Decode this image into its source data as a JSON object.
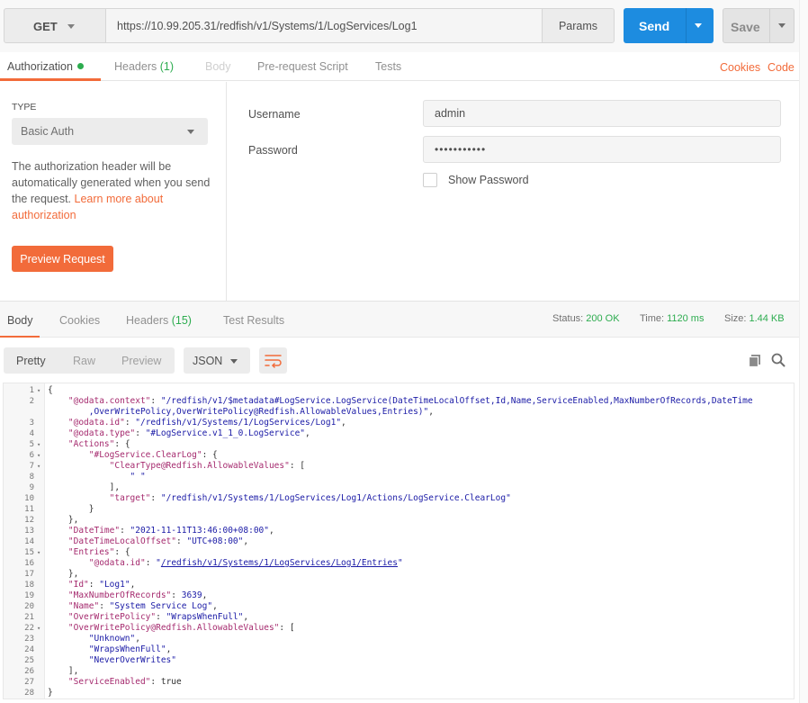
{
  "request": {
    "method": "GET",
    "url": "https://10.99.205.31/redfish/v1/Systems/1/LogServices/Log1",
    "params_label": "Params",
    "send_label": "Send",
    "save_label": "Save"
  },
  "request_tabs": {
    "authorization": "Authorization",
    "headers": "Headers",
    "headers_count": "(1)",
    "body": "Body",
    "prerequest": "Pre-request Script",
    "tests": "Tests",
    "cookies": "Cookies",
    "code": "Code"
  },
  "auth": {
    "type_label": "TYPE",
    "type_value": "Basic Auth",
    "help_text": "The authorization header will be automatically generated when you send the request. ",
    "learn_more": "Learn more about authorization",
    "preview_button": "Preview Request",
    "username_label": "Username",
    "username_value": "admin",
    "password_label": "Password",
    "password_value": "•••••••••••",
    "show_password_label": "Show Password"
  },
  "response_tabs": {
    "body": "Body",
    "cookies": "Cookies",
    "headers": "Headers",
    "headers_count": "(15)",
    "test_results": "Test Results"
  },
  "status": {
    "status_label": "Status:",
    "status_value": "200 OK",
    "time_label": "Time:",
    "time_value": "1120 ms",
    "size_label": "Size:",
    "size_value": "1.44 KB"
  },
  "view": {
    "pretty": "Pretty",
    "raw": "Raw",
    "preview": "Preview",
    "format": "JSON"
  },
  "icons": [
    "chevron-down-icon",
    "wrap-lines-icon",
    "copy-icon",
    "search-icon",
    "fold-arrow-icon"
  ],
  "colors": {
    "accent": "#f26b3a",
    "send": "#1d8ce0",
    "success": "#2dac4f"
  },
  "code_lines": [
    {
      "n": "1",
      "fold": true,
      "t": [
        [
          "p",
          "{"
        ]
      ]
    },
    {
      "n": "2",
      "fold": false,
      "t": [
        [
          "p",
          "    "
        ],
        [
          "k",
          "\"@odata.context\""
        ],
        [
          "p",
          ": "
        ],
        [
          "s",
          "\"/redfish/v1/$metadata#LogService.LogService(DateTimeLocalOffset,Id,Name,ServiceEnabled,MaxNumberOfRecords,DateTime"
        ]
      ]
    },
    {
      "n": "",
      "fold": false,
      "t": [
        [
          "s",
          "        ,OverWritePolicy,OverWritePolicy@Redfish.AllowableValues,Entries)\""
        ],
        [
          "p",
          ","
        ]
      ]
    },
    {
      "n": "3",
      "fold": false,
      "t": [
        [
          "p",
          "    "
        ],
        [
          "k",
          "\"@odata.id\""
        ],
        [
          "p",
          ": "
        ],
        [
          "s",
          "\"/redfish/v1/Systems/1/LogServices/Log1\""
        ],
        [
          "p",
          ","
        ]
      ]
    },
    {
      "n": "4",
      "fold": false,
      "t": [
        [
          "p",
          "    "
        ],
        [
          "k",
          "\"@odata.type\""
        ],
        [
          "p",
          ": "
        ],
        [
          "s",
          "\"#LogService.v1_1_0.LogService\""
        ],
        [
          "p",
          ","
        ]
      ]
    },
    {
      "n": "5",
      "fold": true,
      "t": [
        [
          "p",
          "    "
        ],
        [
          "k",
          "\"Actions\""
        ],
        [
          "p",
          ": {"
        ]
      ]
    },
    {
      "n": "6",
      "fold": true,
      "t": [
        [
          "p",
          "        "
        ],
        [
          "k",
          "\"#LogService.ClearLog\""
        ],
        [
          "p",
          ": {"
        ]
      ]
    },
    {
      "n": "7",
      "fold": true,
      "t": [
        [
          "p",
          "            "
        ],
        [
          "k",
          "\"ClearType@Redfish.AllowableValues\""
        ],
        [
          "p",
          ": ["
        ]
      ]
    },
    {
      "n": "8",
      "fold": false,
      "t": [
        [
          "p",
          "                "
        ],
        [
          "s",
          "\" \""
        ]
      ]
    },
    {
      "n": "9",
      "fold": false,
      "t": [
        [
          "p",
          "            ],"
        ]
      ]
    },
    {
      "n": "10",
      "fold": false,
      "t": [
        [
          "p",
          "            "
        ],
        [
          "k",
          "\"target\""
        ],
        [
          "p",
          ": "
        ],
        [
          "s",
          "\"/redfish/v1/Systems/1/LogServices/Log1/Actions/LogService.ClearLog\""
        ]
      ]
    },
    {
      "n": "11",
      "fold": false,
      "t": [
        [
          "p",
          "        }"
        ]
      ]
    },
    {
      "n": "12",
      "fold": false,
      "t": [
        [
          "p",
          "    },"
        ]
      ]
    },
    {
      "n": "13",
      "fold": false,
      "t": [
        [
          "p",
          "    "
        ],
        [
          "k",
          "\"DateTime\""
        ],
        [
          "p",
          ": "
        ],
        [
          "s",
          "\"2021-11-11T13:46:00+08:00\""
        ],
        [
          "p",
          ","
        ]
      ]
    },
    {
      "n": "14",
      "fold": false,
      "t": [
        [
          "p",
          "    "
        ],
        [
          "k",
          "\"DateTimeLocalOffset\""
        ],
        [
          "p",
          ": "
        ],
        [
          "s",
          "\"UTC+08:00\""
        ],
        [
          "p",
          ","
        ]
      ]
    },
    {
      "n": "15",
      "fold": true,
      "t": [
        [
          "p",
          "    "
        ],
        [
          "k",
          "\"Entries\""
        ],
        [
          "p",
          ": {"
        ]
      ]
    },
    {
      "n": "16",
      "fold": false,
      "t": [
        [
          "p",
          "        "
        ],
        [
          "k",
          "\"@odata.id\""
        ],
        [
          "p",
          ": "
        ],
        [
          "s",
          "\""
        ],
        [
          "u",
          "/redfish/v1/Systems/1/LogServices/Log1/Entries"
        ],
        [
          "s",
          "\""
        ]
      ]
    },
    {
      "n": "17",
      "fold": false,
      "t": [
        [
          "p",
          "    },"
        ]
      ]
    },
    {
      "n": "18",
      "fold": false,
      "t": [
        [
          "p",
          "    "
        ],
        [
          "k",
          "\"Id\""
        ],
        [
          "p",
          ": "
        ],
        [
          "s",
          "\"Log1\""
        ],
        [
          "p",
          ","
        ]
      ]
    },
    {
      "n": "19",
      "fold": false,
      "t": [
        [
          "p",
          "    "
        ],
        [
          "k",
          "\"MaxNumberOfRecords\""
        ],
        [
          "p",
          ": "
        ],
        [
          "n",
          "3639"
        ],
        [
          "p",
          ","
        ]
      ]
    },
    {
      "n": "20",
      "fold": false,
      "t": [
        [
          "p",
          "    "
        ],
        [
          "k",
          "\"Name\""
        ],
        [
          "p",
          ": "
        ],
        [
          "s",
          "\"System Service Log\""
        ],
        [
          "p",
          ","
        ]
      ]
    },
    {
      "n": "21",
      "fold": false,
      "t": [
        [
          "p",
          "    "
        ],
        [
          "k",
          "\"OverWritePolicy\""
        ],
        [
          "p",
          ": "
        ],
        [
          "s",
          "\"WrapsWhenFull\""
        ],
        [
          "p",
          ","
        ]
      ]
    },
    {
      "n": "22",
      "fold": true,
      "t": [
        [
          "p",
          "    "
        ],
        [
          "k",
          "\"OverWritePolicy@Redfish.AllowableValues\""
        ],
        [
          "p",
          ": ["
        ]
      ]
    },
    {
      "n": "23",
      "fold": false,
      "t": [
        [
          "p",
          "        "
        ],
        [
          "s",
          "\"Unknown\""
        ],
        [
          "p",
          ","
        ]
      ]
    },
    {
      "n": "24",
      "fold": false,
      "t": [
        [
          "p",
          "        "
        ],
        [
          "s",
          "\"WrapsWhenFull\""
        ],
        [
          "p",
          ","
        ]
      ]
    },
    {
      "n": "25",
      "fold": false,
      "t": [
        [
          "p",
          "        "
        ],
        [
          "s",
          "\"NeverOverWrites\""
        ]
      ]
    },
    {
      "n": "26",
      "fold": false,
      "t": [
        [
          "p",
          "    ],"
        ]
      ]
    },
    {
      "n": "27",
      "fold": false,
      "t": [
        [
          "p",
          "    "
        ],
        [
          "k",
          "\"ServiceEnabled\""
        ],
        [
          "p",
          ": "
        ],
        [
          "p",
          "true"
        ]
      ]
    },
    {
      "n": "28",
      "fold": false,
      "t": [
        [
          "p",
          "}"
        ]
      ]
    }
  ]
}
